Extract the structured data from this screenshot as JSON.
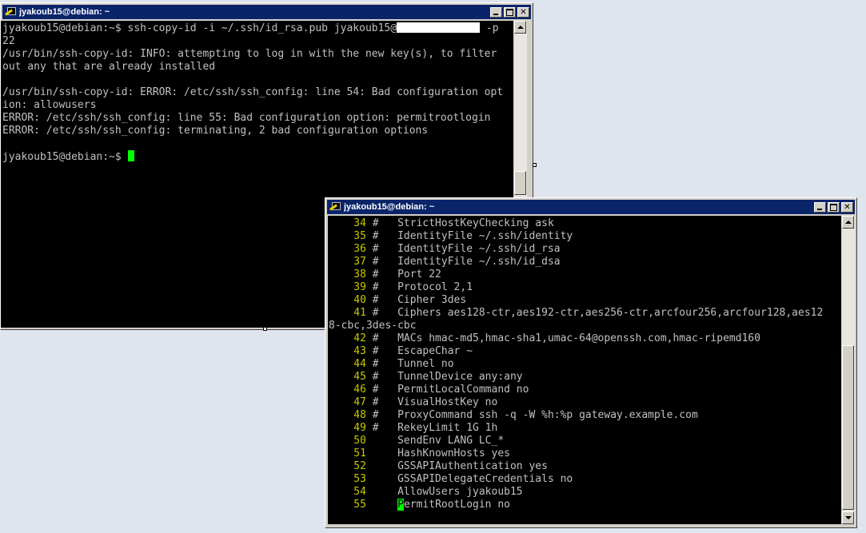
{
  "window1": {
    "title": "jyakoub15@debian: ~",
    "lines": [
      {
        "before": "jyakoub15@debian:~$ ssh-copy-id -i ~/.ssh/id_rsa.pub jyakoub15@",
        "after": " -p"
      },
      {
        "text": "22"
      },
      {
        "text": "/usr/bin/ssh-copy-id: INFO: attempting to log in with the new key(s), to filter"
      },
      {
        "text": "out any that are already installed"
      },
      {
        "text": ""
      },
      {
        "text": "/usr/bin/ssh-copy-id: ERROR: /etc/ssh/ssh_config: line 54: Bad configuration opt"
      },
      {
        "text": "ion: allowusers"
      },
      {
        "text": "ERROR: /etc/ssh/ssh_config: line 55: Bad configuration option: permitrootlogin"
      },
      {
        "text": "ERROR: /etc/ssh/ssh_config: terminating, 2 bad configuration options"
      },
      {
        "text": ""
      },
      {
        "text": "jyakoub15@debian:~$ "
      }
    ]
  },
  "window2": {
    "title": "jyakoub15@debian: ~",
    "lines": [
      {
        "num": "34",
        "text": " #   StrictHostKeyChecking ask"
      },
      {
        "num": "35",
        "text": " #   IdentityFile ~/.ssh/identity"
      },
      {
        "num": "36",
        "text": " #   IdentityFile ~/.ssh/id_rsa"
      },
      {
        "num": "37",
        "text": " #   IdentityFile ~/.ssh/id_dsa"
      },
      {
        "num": "38",
        "text": " #   Port 22"
      },
      {
        "num": "39",
        "text": " #   Protocol 2,1"
      },
      {
        "num": "40",
        "text": " #   Cipher 3des"
      },
      {
        "num": "41",
        "text": " #   Ciphers aes128-ctr,aes192-ctr,aes256-ctr,arcfour256,arcfour128,aes12"
      },
      {
        "num": "",
        "text": "8-cbc,3des-cbc"
      },
      {
        "num": "42",
        "text": " #   MACs hmac-md5,hmac-sha1,umac-64@openssh.com,hmac-ripemd160"
      },
      {
        "num": "43",
        "text": " #   EscapeChar ~"
      },
      {
        "num": "44",
        "text": " #   Tunnel no"
      },
      {
        "num": "45",
        "text": " #   TunnelDevice any:any"
      },
      {
        "num": "46",
        "text": " #   PermitLocalCommand no"
      },
      {
        "num": "47",
        "text": " #   VisualHostKey no"
      },
      {
        "num": "48",
        "text": " #   ProxyCommand ssh -q -W %h:%p gateway.example.com"
      },
      {
        "num": "49",
        "text": " #   RekeyLimit 1G 1h"
      },
      {
        "num": "50",
        "text": "     SendEnv LANG LC_*"
      },
      {
        "num": "51",
        "text": "     HashKnownHosts yes"
      },
      {
        "num": "52",
        "text": "     GSSAPIAuthentication yes"
      },
      {
        "num": "53",
        "text": "     GSSAPIDelegateCredentials no"
      },
      {
        "num": "54",
        "text": "     AllowUsers jyakoub15"
      },
      {
        "num": "55",
        "text": "     ",
        "cursor": "P",
        "after": "ermitRootLogin no"
      }
    ]
  },
  "colors": {
    "titlebar": "#0a246a",
    "terminal_bg": "#000000",
    "terminal_fg": "#c0c0c0",
    "line_number": "#c8c800",
    "cursor": "#00ff00"
  }
}
